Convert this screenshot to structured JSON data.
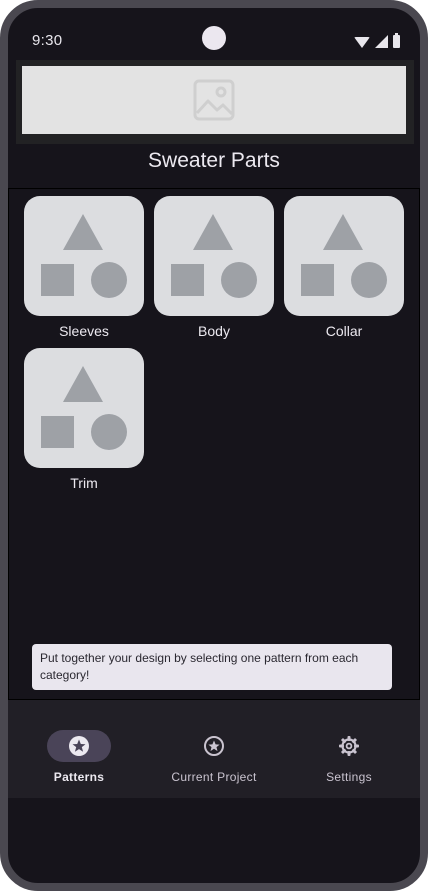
{
  "status_bar": {
    "time": "9:30"
  },
  "banner": {
    "icon": "image-placeholder-icon"
  },
  "page": {
    "title": "Sweater Parts"
  },
  "categories": [
    {
      "label": "Sleeves",
      "icon": "shapes-icon"
    },
    {
      "label": "Body",
      "icon": "shapes-icon"
    },
    {
      "label": "Collar",
      "icon": "shapes-icon"
    },
    {
      "label": "Trim",
      "icon": "shapes-icon"
    }
  ],
  "hint": {
    "text": "Put together your design by selecting one pattern from each category!"
  },
  "nav": {
    "items": [
      {
        "label": "Patterns",
        "icon": "star-circle-icon",
        "active": true
      },
      {
        "label": "Current Project",
        "icon": "star-circle-icon",
        "active": false
      },
      {
        "label": "Settings",
        "icon": "gear-icon",
        "active": false
      }
    ]
  },
  "colors": {
    "background": "#16141b",
    "tile": "#dcdde0",
    "shape": "#9ea1a6",
    "nav_active_indicator": "#4a4458",
    "hint_background": "#e9e6ee"
  }
}
